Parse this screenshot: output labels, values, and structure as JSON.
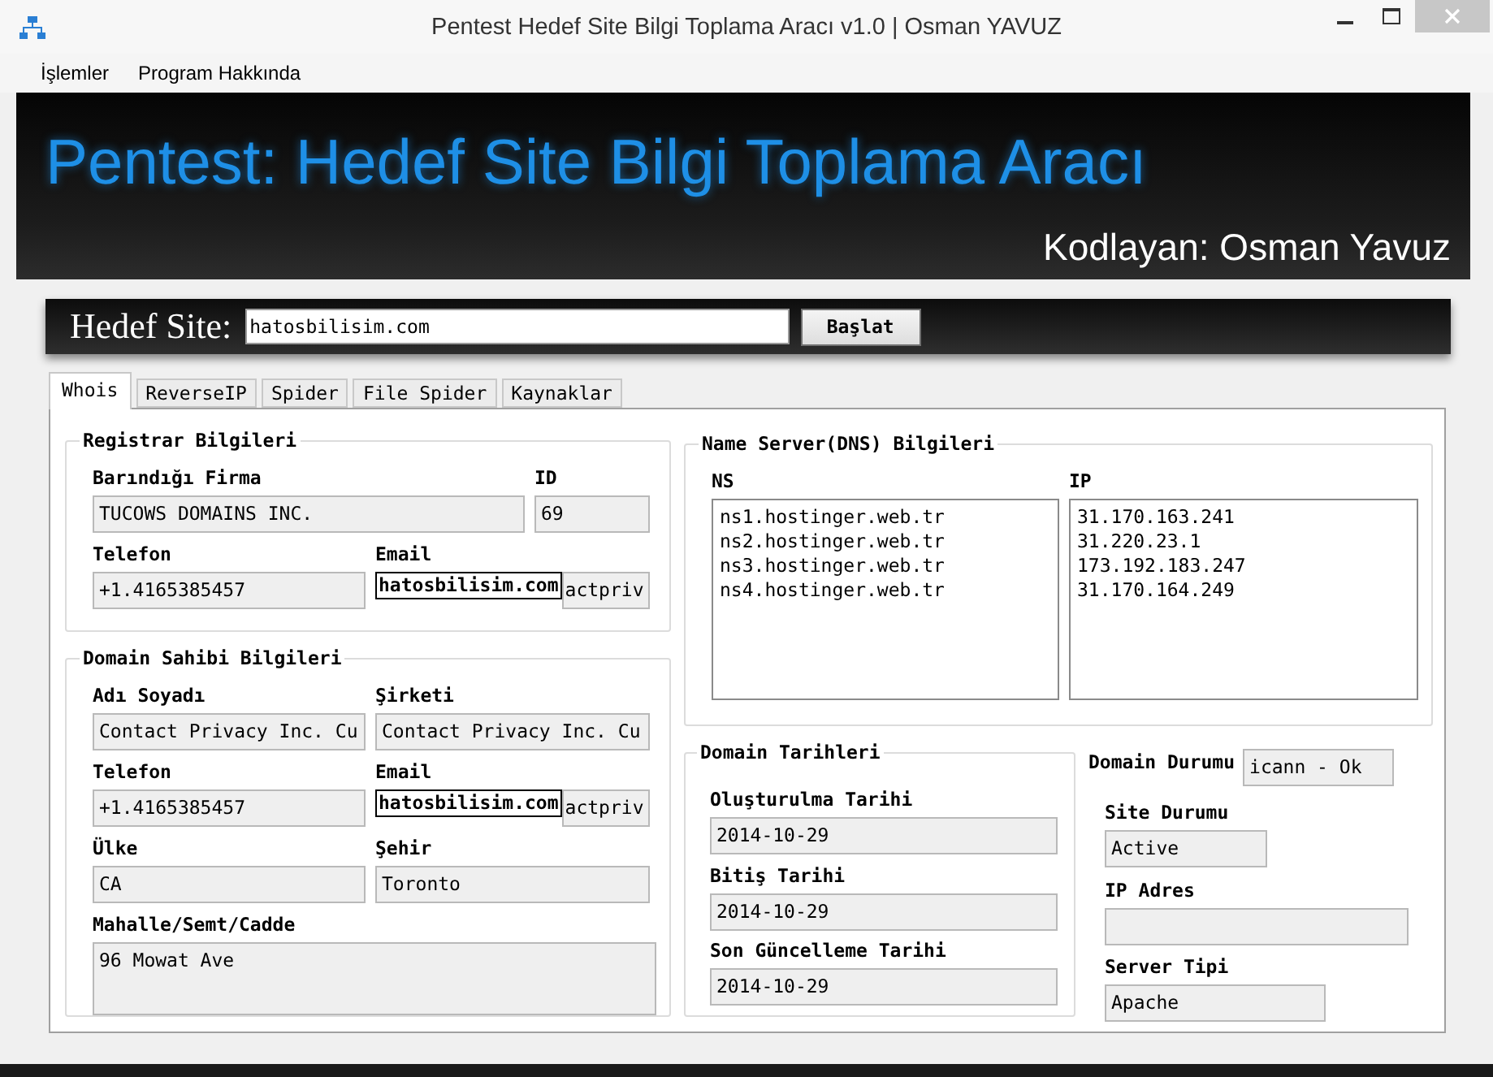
{
  "window": {
    "title": "Pentest Hedef Site Bilgi Toplama Aracı v1.0 | Osman YAVUZ"
  },
  "menu": [
    "İşlemler",
    "Program Hakkında"
  ],
  "banner": {
    "title": "Pentest: Hedef Site Bilgi Toplama Aracı",
    "author": "Kodlayan: Osman Yavuz"
  },
  "target": {
    "label": "Hedef Site:",
    "value": "hatosbilisim.com",
    "button": "Başlat"
  },
  "tabs": [
    {
      "label": "Whois",
      "selected": true
    },
    {
      "label": "ReverseIP",
      "selected": false
    },
    {
      "label": "Spider",
      "selected": false
    },
    {
      "label": "File Spider",
      "selected": false
    },
    {
      "label": "Kaynaklar",
      "selected": false
    }
  ],
  "registrar": {
    "title": "Registrar Bilgileri",
    "firm": {
      "label": "Barındığı Firma",
      "value": "TUCOWS DOMAINS INC."
    },
    "id": {
      "label": "ID",
      "value": "69"
    },
    "phone": {
      "label": "Telefon",
      "value": "+1.4165385457"
    },
    "email": {
      "label": "Email",
      "value": "actpriv",
      "overlay": "hatosbilisim.com"
    }
  },
  "owner": {
    "title": "Domain Sahibi Bilgileri",
    "name": {
      "label": "Adı Soyadı",
      "value": "Contact Privacy Inc. Cu"
    },
    "company": {
      "label": "Şirketi",
      "value": "Contact Privacy Inc. Cu"
    },
    "phone": {
      "label": "Telefon",
      "value": "+1.4165385457"
    },
    "email": {
      "label": "Email",
      "value": "actpriv",
      "overlay": "hatosbilisim.com"
    },
    "country": {
      "label": "Ülke",
      "value": "CA"
    },
    "city": {
      "label": "Şehir",
      "value": "Toronto"
    },
    "address": {
      "label": "Mahalle/Semt/Cadde",
      "value": "96 Mowat Ave"
    }
  },
  "dns": {
    "title": "Name Server(DNS) Bilgileri",
    "ns": {
      "label": "NS",
      "items": [
        "ns1.hostinger.web.tr",
        "ns2.hostinger.web.tr",
        "ns3.hostinger.web.tr",
        "ns4.hostinger.web.tr"
      ]
    },
    "ip": {
      "label": "IP",
      "items": [
        "31.170.163.241",
        "31.220.23.1",
        "173.192.183.247",
        "31.170.164.249"
      ]
    }
  },
  "dates": {
    "title": "Domain Tarihleri",
    "created": {
      "label": "Oluşturulma Tarihi",
      "value": "2014-10-29"
    },
    "expires": {
      "label": "Bitiş Tarihi",
      "value": "2014-10-29"
    },
    "updated": {
      "label": "Son Güncelleme Tarihi",
      "value": "2014-10-29"
    }
  },
  "status": {
    "domain": {
      "label": "Domain Durumu",
      "value": "icann - Ok"
    },
    "site": {
      "label": "Site Durumu",
      "value": "Active"
    },
    "ip": {
      "label": "IP Adres"
    },
    "server": {
      "label": "Server Tipi",
      "value": "Apache"
    }
  }
}
